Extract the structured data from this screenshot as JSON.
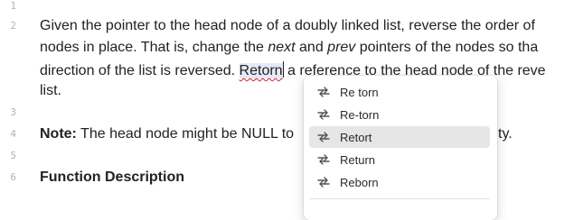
{
  "line_numbers": [
    "1",
    "2",
    "3",
    "4",
    "5",
    "6"
  ],
  "paragraph": {
    "l1": "Given the pointer to the head node of a doubly linked list, reverse the order of",
    "l2_a": "nodes in place. That is, change the ",
    "l2_next": "next",
    "l2_b": " and ",
    "l2_prev": "prev",
    "l2_c": " pointers of the nodes so tha",
    "l3_a": "direction of the list is reversed. ",
    "l3_word": "Retorn",
    "l3_b": " a reference to the head node of the reve",
    "l4": "list."
  },
  "note": {
    "label": "Note:",
    "text_left": " The head node might be NULL to",
    "text_right": "ty."
  },
  "heading": "Function Description",
  "spell_menu": {
    "items": [
      {
        "label": "Re torn",
        "icon": "replace-icon"
      },
      {
        "label": "Re-torn",
        "icon": "replace-icon"
      },
      {
        "label": "Retort",
        "icon": "replace-icon",
        "highlighted": true
      },
      {
        "label": "Return",
        "icon": "replace-icon"
      },
      {
        "label": "Reborn",
        "icon": "replace-icon"
      }
    ]
  },
  "colors": {
    "misspelling_underline": "#d0212d",
    "selection_bg": "#e6e8f6",
    "menu_highlight": "#e6e6e6"
  }
}
